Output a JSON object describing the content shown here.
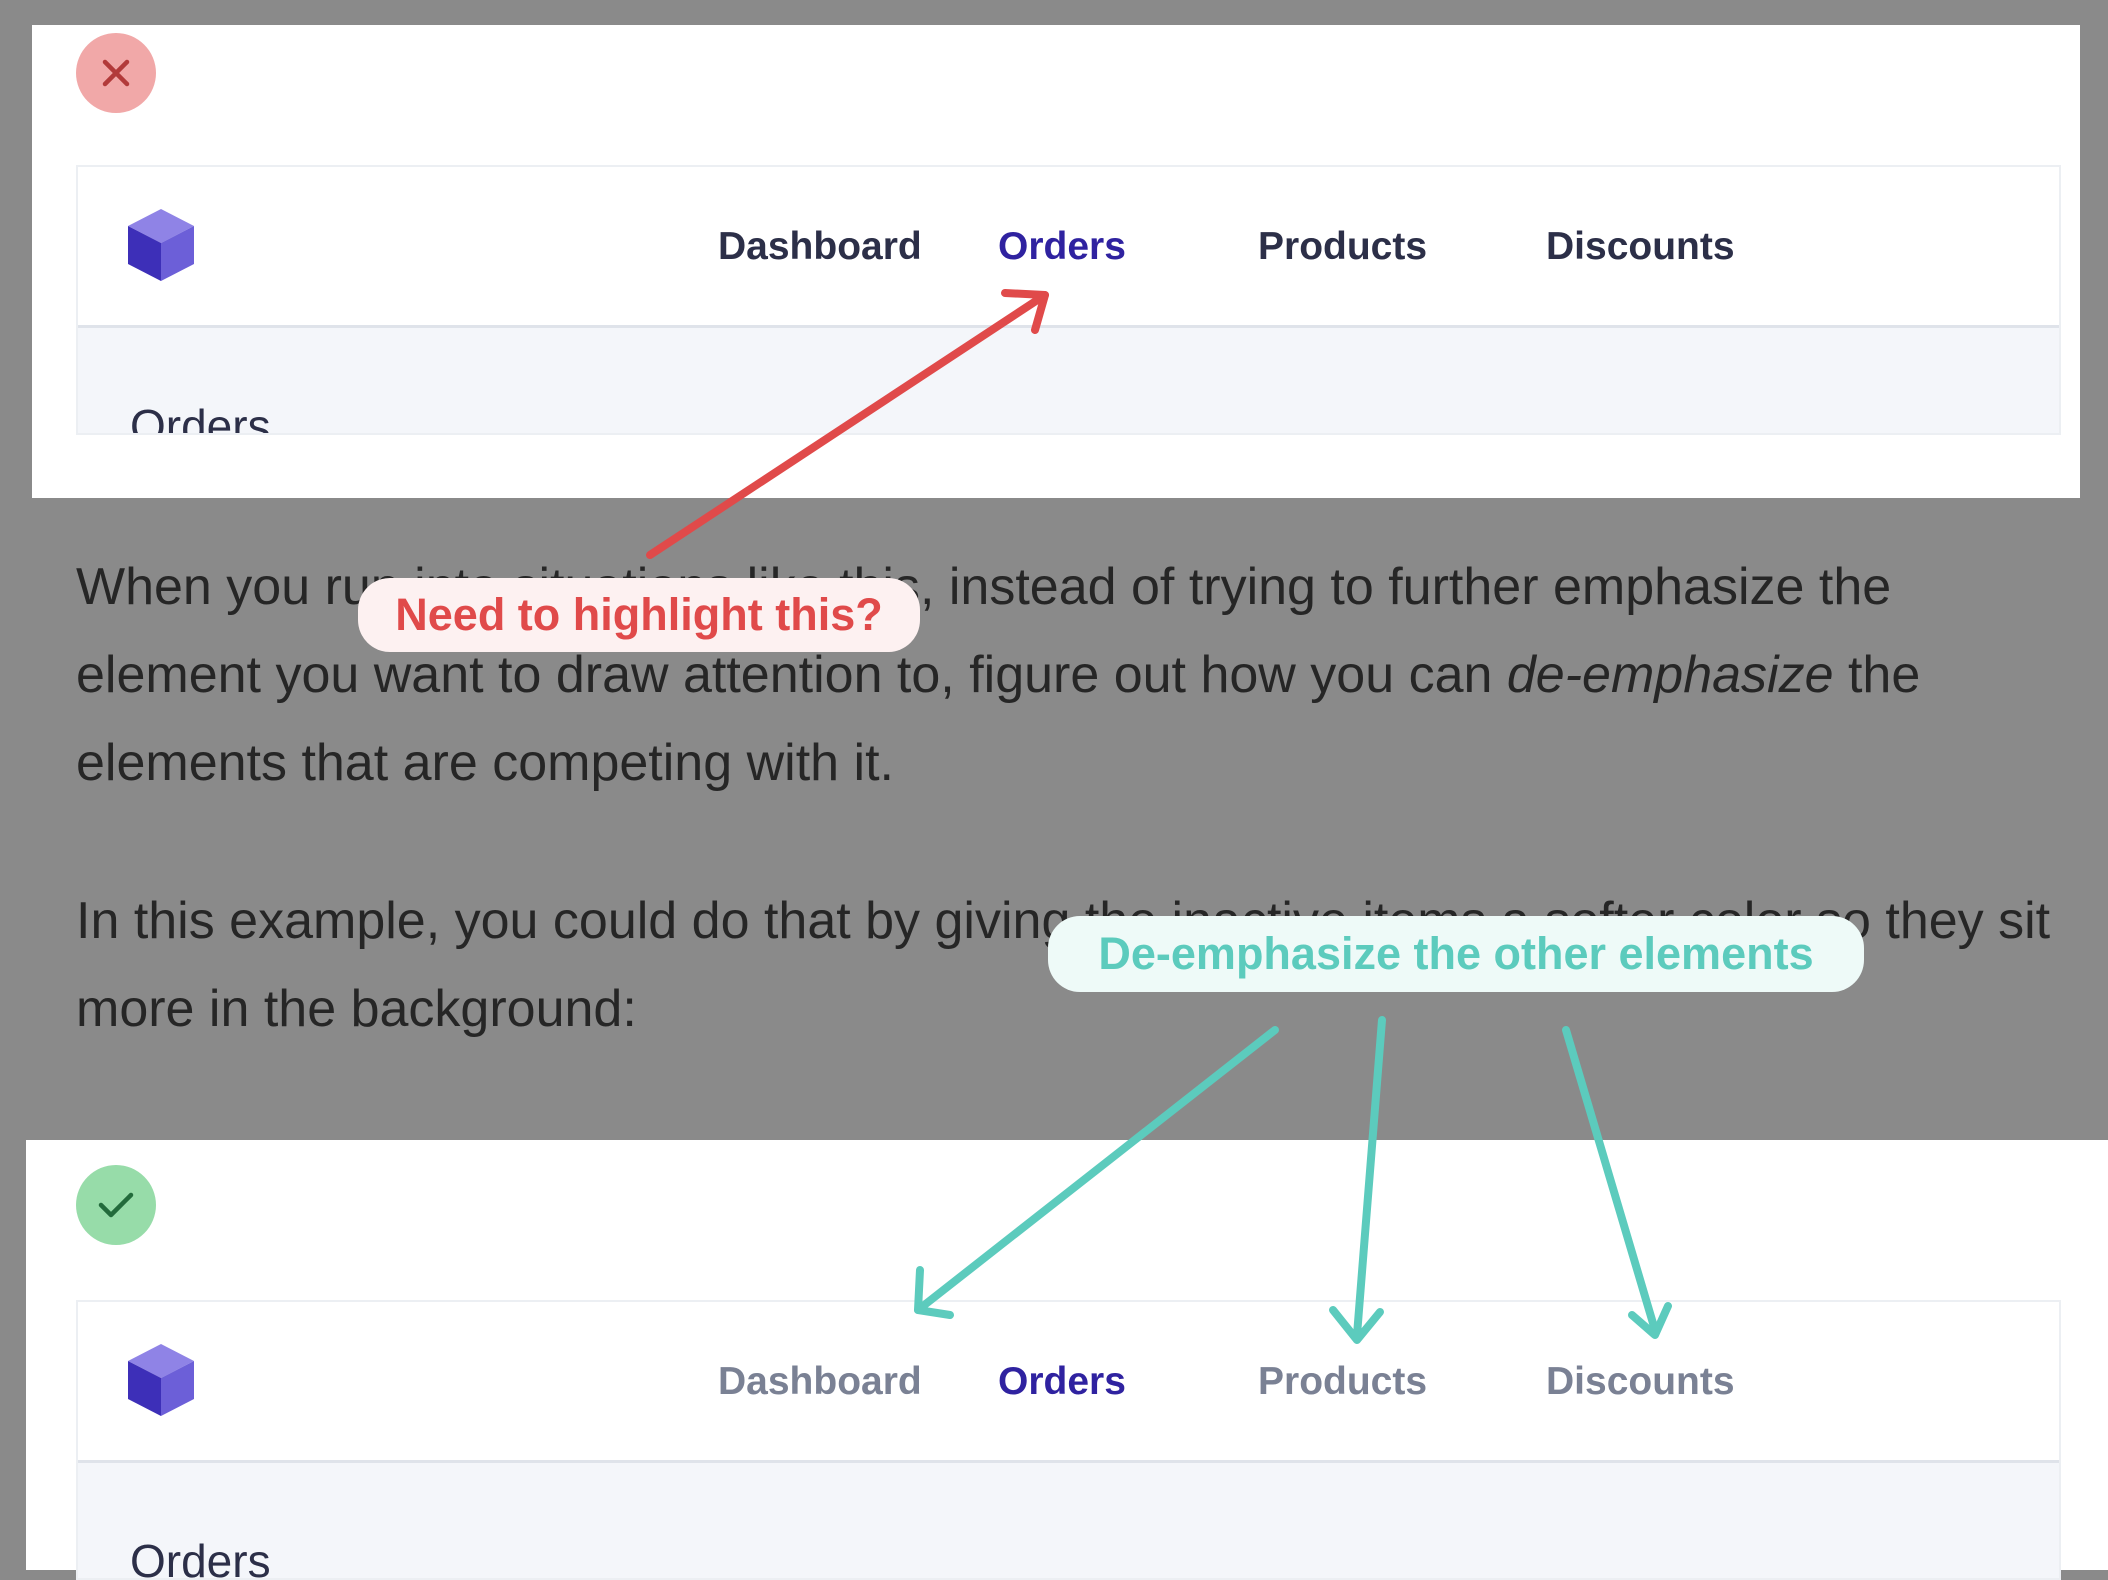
{
  "colors": {
    "accent": "#2f22a0",
    "nav_active": "#2f22a0",
    "nav_inactive_strong": "#2c2f48",
    "nav_inactive_soft": "#7a8194",
    "bad_badge": "#f1a8a8",
    "bad_mark": "#b23a3a",
    "good_badge": "#97dca9",
    "good_mark": "#236b3c",
    "annotation_red": "#e04a4a",
    "annotation_teal": "#5ccbbd"
  },
  "example_bad": {
    "badge_icon": "close-icon",
    "logo_icon": "cube-icon",
    "nav": {
      "items": [
        "Dashboard",
        "Orders",
        "Products",
        "Discounts"
      ],
      "active": "Orders"
    },
    "page_heading": "Orders"
  },
  "prose": {
    "paragraph_1": {
      "text_before_em1": "When you run into situations like this, instead of trying to further emphasize the element you want to draw attention to, figure out how you can ",
      "em1": "de-emphasize",
      "text_after_em1": " the elements that are competing with it."
    },
    "paragraph_2": "In this example, you could do that by giving the inactive items a softer color so they sit more in the background:"
  },
  "annotations": {
    "highlight_callout": "Need to highlight this?",
    "deemphasize_callout": "De-emphasize the other elements"
  },
  "example_good": {
    "badge_icon": "check-icon",
    "logo_icon": "cube-icon",
    "nav": {
      "items": [
        "Dashboard",
        "Orders",
        "Products",
        "Discounts"
      ],
      "active": "Orders"
    },
    "page_heading": "Orders"
  }
}
